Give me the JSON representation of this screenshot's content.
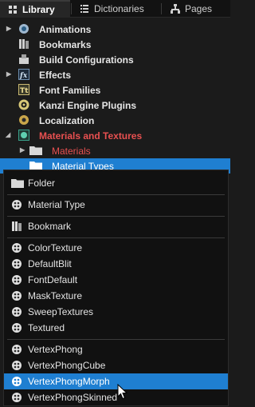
{
  "tabs": [
    {
      "label": "Library"
    },
    {
      "label": "Dictionaries"
    },
    {
      "label": "Pages"
    }
  ],
  "tree": {
    "items": [
      {
        "label": "Animations",
        "icon": "animations-icon"
      },
      {
        "label": "Bookmarks",
        "icon": "bookmarks-icon"
      },
      {
        "label": "Build Configurations",
        "icon": "build-configurations-icon"
      },
      {
        "label": "Effects",
        "icon": "effects-icon"
      },
      {
        "label": "Font Families",
        "icon": "font-families-icon"
      },
      {
        "label": "Kanzi Engine Plugins",
        "icon": "plugins-icon"
      },
      {
        "label": "Localization",
        "icon": "localization-icon"
      },
      {
        "label": "Materials and Textures",
        "icon": "materials-and-textures-icon"
      },
      {
        "label": "Materials",
        "icon": "folder-icon"
      },
      {
        "label": "Material Types",
        "icon": "folder-icon"
      }
    ]
  },
  "menu": {
    "items": [
      {
        "label": "Folder",
        "icon": "folder-icon"
      },
      {
        "label": "Material Type",
        "icon": "material-type-icon"
      },
      {
        "label": "Bookmark",
        "icon": "bookmark-icon"
      },
      {
        "label": "ColorTexture",
        "icon": "material-type-icon"
      },
      {
        "label": "DefaultBlit",
        "icon": "material-type-icon"
      },
      {
        "label": "FontDefault",
        "icon": "material-type-icon"
      },
      {
        "label": "MaskTexture",
        "icon": "material-type-icon"
      },
      {
        "label": "SweepTextures",
        "icon": "material-type-icon"
      },
      {
        "label": "Textured",
        "icon": "material-type-icon"
      },
      {
        "label": "VertexPhong",
        "icon": "material-type-icon"
      },
      {
        "label": "VertexPhongCube",
        "icon": "material-type-icon"
      },
      {
        "label": "VertexPhongMorph",
        "icon": "material-type-icon"
      },
      {
        "label": "VertexPhongSkinned",
        "icon": "material-type-icon"
      }
    ]
  },
  "colors": {
    "selection": "#1f7fd1",
    "highlight_text": "#e85050",
    "background": "#1b1b1b"
  }
}
